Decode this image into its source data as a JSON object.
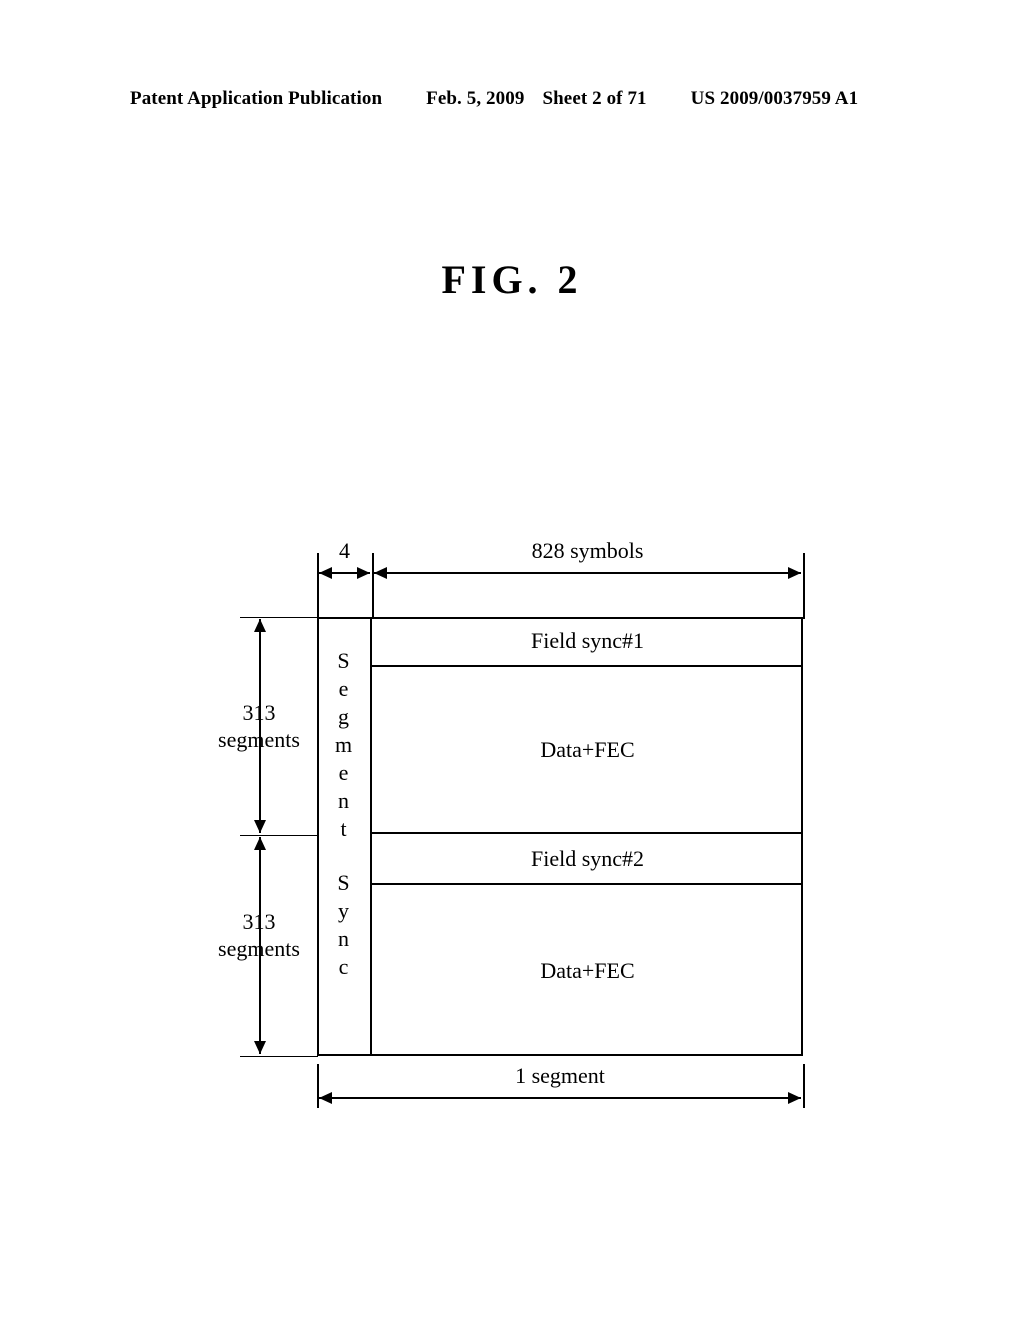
{
  "header": {
    "publication": "Patent Application Publication",
    "date": "Feb. 5, 2009",
    "sheet": "Sheet 2 of 71",
    "patent_number": "US 2009/0037959 A1"
  },
  "figure": {
    "title": "FIG. 2",
    "sync_column": {
      "word_top": "Segment",
      "word_bottom": "Sync"
    },
    "rows": [
      {
        "label": "Field sync#1"
      },
      {
        "label": "Data+FEC"
      },
      {
        "label": "Field sync#2"
      },
      {
        "label": "Data+FEC"
      }
    ],
    "dimensions": {
      "top_left": "4",
      "top_right": "828 symbols",
      "bottom": "1 segment",
      "left_upper_line1": "313",
      "left_upper_line2": "segments",
      "left_lower_line1": "313",
      "left_lower_line2": "segments"
    }
  },
  "colors": {
    "ink": "#000000",
    "paper": "#ffffff"
  }
}
